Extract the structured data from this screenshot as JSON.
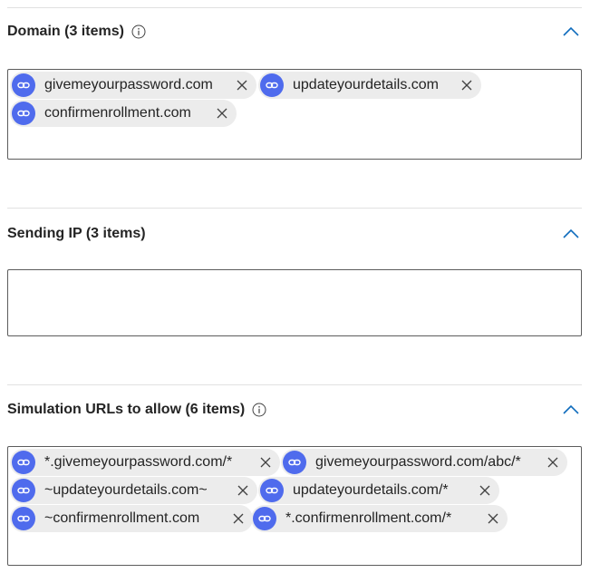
{
  "sections": [
    {
      "title": "Domain (3 items)",
      "has_info": true,
      "items": [
        {
          "text": "givemeyourpassword.com"
        },
        {
          "text": "updateyourdetails.com"
        },
        {
          "text": "confirmenrollment.com"
        }
      ]
    },
    {
      "title": "Sending IP (3 items)",
      "has_info": false,
      "items": []
    },
    {
      "title": "Simulation URLs to allow (6 items)",
      "has_info": true,
      "items": [
        {
          "text": "*.givemeyourpassword.com/*"
        },
        {
          "text": "givemeyourpassword.com/abc/*"
        },
        {
          "text": "~updateyourdetails.com~"
        },
        {
          "text": "updateyourdetails.com/*"
        },
        {
          "text": "~confirmenrollment.com"
        },
        {
          "text": "*.confirmenrollment.com/*"
        }
      ]
    }
  ],
  "colors": {
    "accent": "#0f6cbd",
    "pill_icon": "#4f6bed",
    "pill_bg": "#ececec"
  },
  "icons": {
    "info": "info-icon",
    "collapse": "chevron-up-icon",
    "pill": "link-icon",
    "remove": "close-icon"
  }
}
